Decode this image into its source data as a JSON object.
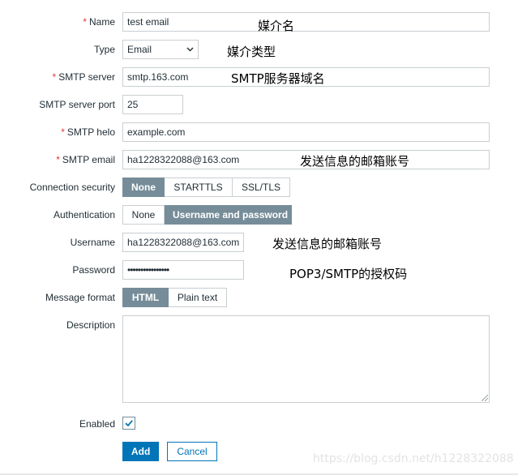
{
  "form": {
    "name": {
      "label": "Name",
      "value": "test email",
      "required": true
    },
    "type": {
      "label": "Type",
      "value": "Email"
    },
    "smtp_server": {
      "label": "SMTP server",
      "value": "smtp.163.com",
      "required": true
    },
    "smtp_server_port": {
      "label": "SMTP server port",
      "value": "25"
    },
    "smtp_helo": {
      "label": "SMTP helo",
      "value": "example.com",
      "required": true
    },
    "smtp_email": {
      "label": "SMTP email",
      "value": "ha1228322088@163.com",
      "required": true
    },
    "connection_security": {
      "label": "Connection security",
      "options": [
        "None",
        "STARTTLS",
        "SSL/TLS"
      ],
      "selected": "None"
    },
    "authentication": {
      "label": "Authentication",
      "options": [
        "None",
        "Username and password"
      ],
      "selected": "Username and password"
    },
    "username": {
      "label": "Username",
      "value": "ha1228322088@163.com"
    },
    "password": {
      "label": "Password",
      "value": "••••••••••••••••"
    },
    "message_format": {
      "label": "Message format",
      "options": [
        "HTML",
        "Plain text"
      ],
      "selected": "HTML"
    },
    "description": {
      "label": "Description",
      "value": ""
    },
    "enabled": {
      "label": "Enabled",
      "checked": true
    },
    "required_marker": "*"
  },
  "buttons": {
    "add": "Add",
    "cancel": "Cancel"
  },
  "annotations": {
    "name": "媒介名",
    "type": "媒介类型",
    "smtp_server": "SMTP服务器域名",
    "smtp_email": "发送信息的邮箱账号",
    "username": "发送信息的邮箱账号",
    "password": "POP3/SMTP的授权码"
  },
  "watermark": "https://blog.csdn.net/h1228322088",
  "colors": {
    "required": "#e33734",
    "segment_active": "#768d99",
    "primary_button": "#0275b8",
    "field_border": "#c9cfd2"
  }
}
